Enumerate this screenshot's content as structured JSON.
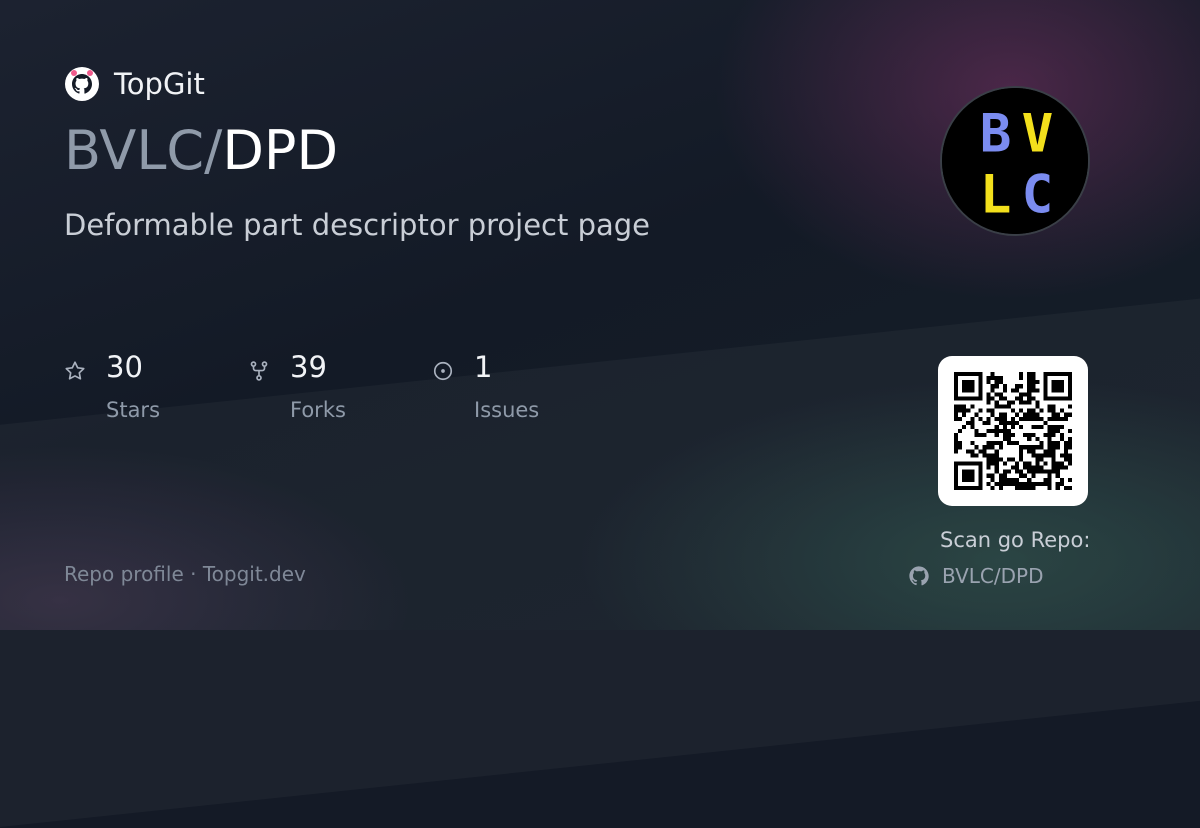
{
  "brand": {
    "name": "TopGit"
  },
  "repo": {
    "owner": "BVLC",
    "separator": "/",
    "name": "DPD",
    "description": "Deformable part descriptor project page"
  },
  "avatar": {
    "line1": [
      "B",
      "V"
    ],
    "line2": [
      "L",
      "C"
    ],
    "colors": {
      "blue": "#7b8cf0",
      "yellow": "#f3e01c",
      "background": "#000000"
    }
  },
  "stats": [
    {
      "icon": "star-icon",
      "value": "30",
      "label": "Stars"
    },
    {
      "icon": "fork-icon",
      "value": "39",
      "label": "Forks"
    },
    {
      "icon": "issue-icon",
      "value": "1",
      "label": "Issues"
    }
  ],
  "scan": {
    "label": "Scan go Repo:",
    "repo_link": "BVLC/DPD",
    "icon": "github-icon"
  },
  "footer": {
    "text": "Repo profile · Topgit.dev"
  },
  "colors": {
    "background": "#141a26",
    "text": "#ffffff",
    "muted": "#8f9aa9"
  }
}
